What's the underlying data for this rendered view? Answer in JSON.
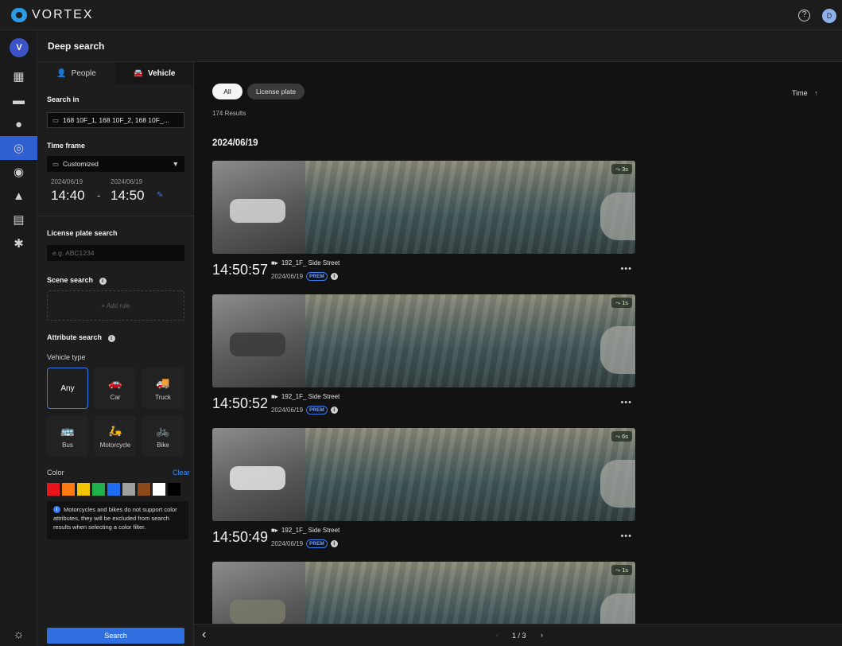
{
  "app": {
    "brand": "VORTEX",
    "user_initial": "D",
    "workspace_initial": "V"
  },
  "colors": {
    "accent": "#2f6fe0",
    "brand": "#2b9be6"
  },
  "page": {
    "title": "Deep search"
  },
  "tabs": [
    {
      "label": "People",
      "icon": "person-icon"
    },
    {
      "label": "Vehicle",
      "icon": "car-icon"
    }
  ],
  "filters": {
    "search_in_label": "Search in",
    "search_in_value": "168 10F_1, 168 10F_2, 168 10F_...",
    "time_frame_label": "Time frame",
    "time_frame_value": "Customized",
    "start_date": "2024/06/19",
    "start_time": "14:40",
    "range_sep": "-",
    "end_date": "2024/06/19",
    "end_time": "14:50",
    "plate_label": "License plate search",
    "plate_placeholder": "e.g. ABC1234",
    "scene_label": "Scene search",
    "add_rule": "+ Add rule",
    "attribute_label": "Attribute search",
    "vehicle_type_label": "Vehicle type",
    "vehicle_types": [
      "Any",
      "Car",
      "Truck",
      "Bus",
      "Motorcycle",
      "Bike"
    ],
    "color_label": "Color",
    "clear_label": "Clear",
    "colors": [
      "#e8141a",
      "#ff7a10",
      "#f2c500",
      "#22b04a",
      "#1f6cf0",
      "#a0a0a0",
      "#8a4a1a",
      "#ffffff",
      "#000000"
    ],
    "color_note": "Motorcycles and bikes do not support color attributes, they will be excluded from search results when selecting a color filter.",
    "search_button": "Search"
  },
  "results": {
    "chips": [
      "All",
      "License plate"
    ],
    "sort_label": "Time",
    "count": "174 Results",
    "group_date": "2024/06/19",
    "items": [
      {
        "time": "14:50:57",
        "camera": "192_1F_ Side Street",
        "date": "2024/06/19",
        "badge": "PREM",
        "duration": "3s",
        "crop_color": "#d7d7d7"
      },
      {
        "time": "14:50:52",
        "camera": "192_1F_ Side Street",
        "date": "2024/06/19",
        "badge": "PREM",
        "duration": "1s",
        "crop_color": "#3a3a3a"
      },
      {
        "time": "14:50:49",
        "camera": "192_1F_ Side Street",
        "date": "2024/06/19",
        "badge": "PREM",
        "duration": "6s",
        "crop_color": "#e6e6e6"
      },
      {
        "time": "",
        "camera": "",
        "date": "",
        "badge": "",
        "duration": "1s",
        "crop_color": "#7a7a6a"
      }
    ],
    "pagination": {
      "label": "1 / 3"
    }
  }
}
